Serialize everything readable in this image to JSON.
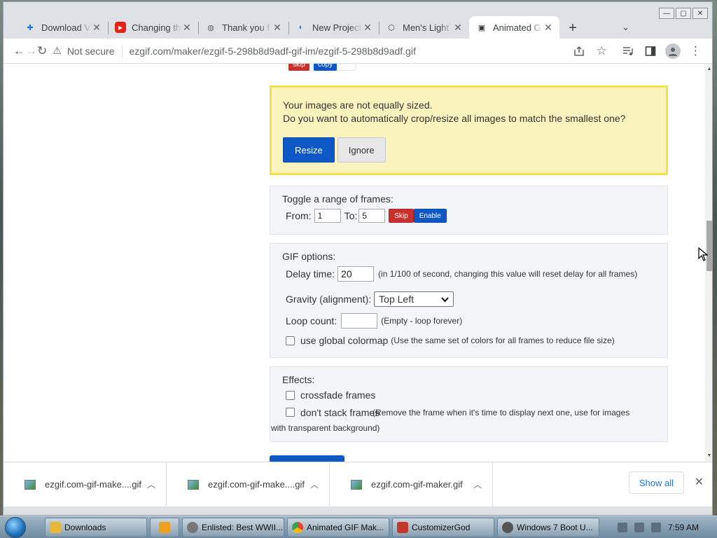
{
  "window": {
    "controls": [
      "—",
      "▢",
      "✕"
    ]
  },
  "tabs": [
    {
      "label": "Download V",
      "color": "#1a73e8",
      "glyph": "✚"
    },
    {
      "label": "Changing th",
      "color": "#e62117",
      "glyph": "▶"
    },
    {
      "label": "Thank you f",
      "color": "#5f6368",
      "glyph": "◍"
    },
    {
      "label": "New Project",
      "color": "#1d8fd6",
      "glyph": "◐"
    },
    {
      "label": "Men's Light",
      "color": "#444",
      "glyph": "⬡"
    },
    {
      "label": "Animated G",
      "color": "#333",
      "glyph": "▣",
      "active": true
    }
  ],
  "newtab_label": "+",
  "tabmenu_glyph": "⌄",
  "toolbar": {
    "back": "←",
    "forward": "→",
    "reload": "↻",
    "security_icon": "⚠",
    "security_label": "Not secure",
    "url": "ezgif.com/maker/ezgif-5-298b8d9adf-gif-im/ezgif-5-298b8d9adf.gif"
  },
  "page": {
    "top_buttons": {
      "skip": "skip",
      "copy": "copy"
    },
    "notice": {
      "line1": "Your images are not equally sized.",
      "line2": "Do you want to automatically crop/resize all images to match the smallest one?",
      "resize": "Resize",
      "ignore": "Ignore"
    },
    "toggle": {
      "heading": "Toggle a range of frames:",
      "from_label": "From:",
      "from_value": "1",
      "to_label": "To:",
      "to_value": "5",
      "skip": "Skip",
      "enable": "Enable"
    },
    "gif": {
      "heading": "GIF options:",
      "delay_label": "Delay time:",
      "delay_value": "20",
      "delay_note": "(in 1/100 of second, changing this value will reset delay for all frames)",
      "gravity_label": "Gravity (alignment):",
      "gravity_value": "Top Left",
      "loop_label": "Loop count:",
      "loop_value": "",
      "loop_note": "(Empty - loop forever)",
      "colormap_label": "use global colormap",
      "colormap_note": "(Use the same set of colors for all frames to reduce file size)"
    },
    "effects": {
      "heading": "Effects:",
      "crossfade": "crossfade frames",
      "nostack": "don't stack frames",
      "nostack_note": "(Remove the frame when it's time to display next one, use for images with transparent background)"
    }
  },
  "downloads": {
    "items": [
      "ezgif.com-gif-make....gif",
      "ezgif.com-gif-make....gif",
      "ezgif.com-gif-maker.gif"
    ],
    "show_all": "Show all",
    "close": "✕"
  },
  "taskbar": {
    "items": [
      {
        "label": "Downloads",
        "color": "#e7b73c"
      },
      {
        "label": "",
        "color": "#f0a020"
      },
      {
        "label": "Enlisted: Best WWII...",
        "color": "#777"
      },
      {
        "label": "Animated GIF Mak...",
        "color": "#34a853"
      },
      {
        "label": "CustomizerGod",
        "color": "#c0392b"
      },
      {
        "label": "Windows 7 Boot U...",
        "color": "#555"
      }
    ],
    "clock": "7:59 AM"
  }
}
